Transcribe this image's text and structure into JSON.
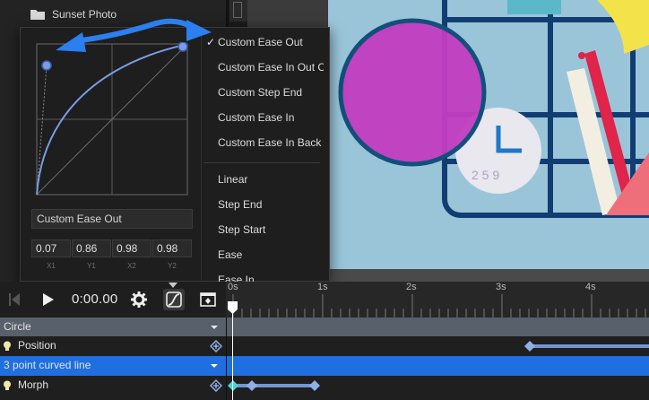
{
  "file_panel": {
    "item_label": "Sunset Photo"
  },
  "easing_popup": {
    "preset_name": "Custom Ease Out",
    "values": [
      {
        "label": "X1",
        "value": "0.07"
      },
      {
        "label": "Y1",
        "value": "0.86"
      },
      {
        "label": "X2",
        "value": "0.98"
      },
      {
        "label": "Y2",
        "value": "0.98"
      }
    ],
    "menu": {
      "selected_index": 0,
      "custom_items": [
        "Custom Ease Out",
        "Custom Ease In Out C",
        "Custom Step End",
        "Custom Ease In",
        "Custom Ease In Back"
      ],
      "builtin_items": [
        "Linear",
        "Step End",
        "Step Start",
        "Ease",
        "Ease In"
      ]
    }
  },
  "timeline": {
    "time": "0:00.00",
    "ruler_labels": [
      "0s",
      "1s",
      "2s",
      "3s",
      "4s"
    ],
    "rows": [
      {
        "name": "Circle",
        "kind": "group"
      },
      {
        "name": "Position",
        "kind": "property"
      },
      {
        "name": "3 point curved line",
        "kind": "group-selected"
      },
      {
        "name": "Morph",
        "kind": "property"
      }
    ]
  },
  "colors": {
    "accent_blue": "#2b7ff0",
    "selected_row": "#1f6fe0",
    "group_row": "#57606b",
    "curve_line": "#7a9ce8",
    "keyframe": "#8fb0e6",
    "keyframe_active": "#45d6d6",
    "canvas_bg": "#9ac5d9",
    "magenta": "#c23cc0"
  }
}
